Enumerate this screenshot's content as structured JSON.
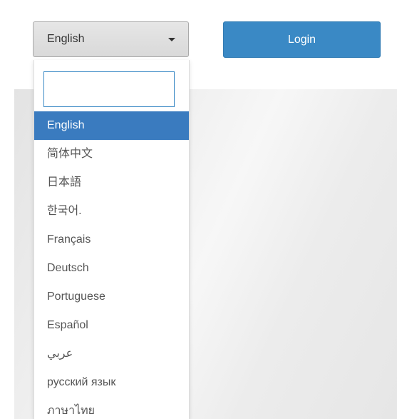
{
  "language_select": {
    "selected": "English",
    "icon": "chevron-down-icon"
  },
  "login_button": {
    "label": "Login"
  },
  "dropdown": {
    "search_value": "",
    "options": [
      "English",
      "简体中文",
      "日本語",
      "한국어.",
      "Français",
      "Deutsch",
      "Portuguese",
      "Español",
      "عربي",
      "русский язык",
      "ภาษาไทย"
    ],
    "selected_index": 0
  },
  "colors": {
    "accent": "#3a89c5",
    "selected_option": "#3a7bbf"
  }
}
